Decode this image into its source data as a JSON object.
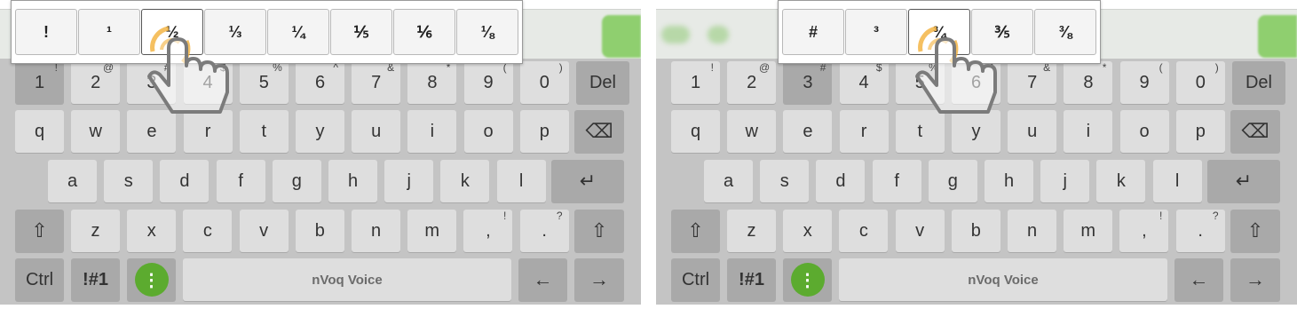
{
  "colors": {
    "keyboard_bg": "#c4c4c4",
    "key_bg": "#dedede",
    "key_dark": "#a9a9a9",
    "mic_green": "#5cab2f",
    "tap_ring": "#f3b03a"
  },
  "left": {
    "popup": {
      "keys": [
        "!",
        "¹",
        "½",
        "⅓",
        "¼",
        "⅕",
        "⅙",
        "⅛"
      ],
      "selected": "½"
    },
    "row1": [
      {
        "main": "1",
        "sup": "!"
      },
      {
        "main": "2",
        "sup": "@"
      },
      {
        "main": "3",
        "sup": "#"
      },
      {
        "main": "4",
        "sup": "$"
      },
      {
        "main": "5",
        "sup": "%"
      },
      {
        "main": "6",
        "sup": "^"
      },
      {
        "main": "7",
        "sup": "&"
      },
      {
        "main": "8",
        "sup": "*"
      },
      {
        "main": "9",
        "sup": "("
      },
      {
        "main": "0",
        "sup": ")"
      },
      {
        "main": "Del",
        "sup": ""
      }
    ]
  },
  "right": {
    "popup": {
      "keys": [
        "#",
        "³",
        "¾",
        "⅗",
        "⅜"
      ],
      "selected": "¾"
    },
    "row1": [
      {
        "main": "1",
        "sup": "!"
      },
      {
        "main": "2",
        "sup": "@"
      },
      {
        "main": "3",
        "sup": "#"
      },
      {
        "main": "4",
        "sup": "$"
      },
      {
        "main": "5",
        "sup": "%"
      },
      {
        "main": "6",
        "sup": "^"
      },
      {
        "main": "7",
        "sup": "&"
      },
      {
        "main": "8",
        "sup": "*"
      },
      {
        "main": "9",
        "sup": "("
      },
      {
        "main": "0",
        "sup": ")"
      },
      {
        "main": "Del",
        "sup": ""
      }
    ]
  },
  "keyboard": {
    "row2": [
      "q",
      "w",
      "e",
      "r",
      "t",
      "y",
      "u",
      "i",
      "o",
      "p"
    ],
    "row3": [
      "a",
      "s",
      "d",
      "f",
      "g",
      "h",
      "j",
      "k",
      "l"
    ],
    "row4": [
      {
        "main": "z",
        "sup": ""
      },
      {
        "main": "x",
        "sup": ""
      },
      {
        "main": "c",
        "sup": ""
      },
      {
        "main": "v",
        "sup": ""
      },
      {
        "main": "b",
        "sup": ""
      },
      {
        "main": "n",
        "sup": ""
      },
      {
        "main": "m",
        "sup": ""
      },
      {
        "main": ",",
        "sup": "!"
      },
      {
        "main": ".",
        "sup": "?"
      }
    ],
    "ctrl_label": "Ctrl",
    "symbols_label": "!#1",
    "space_label": "nVoq Voice",
    "mic_glyph": "⋮",
    "backspace_icon": "⌫",
    "enter_icon": "↵",
    "shift_icon": "⇧",
    "left_arrow": "←",
    "right_arrow": "→",
    "icons": [
      "backspace-icon",
      "enter-icon",
      "shift-icon",
      "left-arrow-icon",
      "right-arrow-icon",
      "tap-gesture-icon",
      "microphone-icon"
    ]
  }
}
